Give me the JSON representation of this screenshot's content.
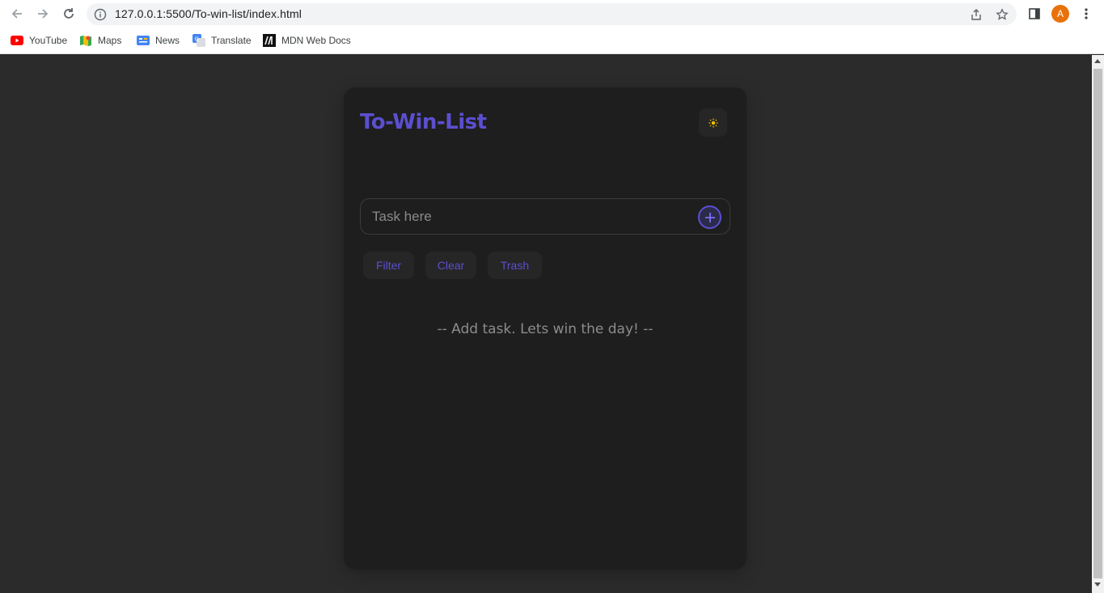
{
  "browser": {
    "url": "127.0.0.1:5500/To-win-list/index.html",
    "profile_initial": "A",
    "bookmarks": [
      {
        "label": "YouTube",
        "icon": "youtube-icon"
      },
      {
        "label": "Maps",
        "icon": "maps-icon"
      },
      {
        "label": "News",
        "icon": "news-icon"
      },
      {
        "label": "Translate",
        "icon": "translate-icon"
      },
      {
        "label": "MDN Web Docs",
        "icon": "mdn-icon"
      }
    ]
  },
  "app": {
    "title": "To-Win-List",
    "theme_toggle_icon": "sun-icon",
    "task_input_placeholder": "Task here",
    "add_button_icon": "plus-icon",
    "actions": {
      "filter": "Filter",
      "clear": "Clear",
      "trash": "Trash"
    },
    "empty_message": "-- Add task. Lets win the day! --"
  },
  "colors": {
    "accent": "#5b4fcf",
    "card_background": "#1e1e1e",
    "page_background": "#2b2b2b",
    "sun": "#f2c200"
  }
}
